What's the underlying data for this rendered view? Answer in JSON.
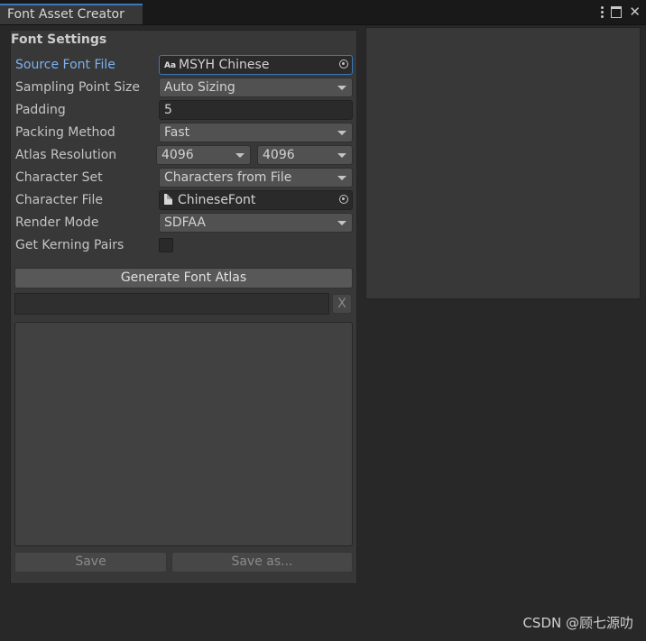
{
  "window": {
    "tab_title": "Font Asset Creator"
  },
  "settings": {
    "section_title": "Font Settings",
    "source_font_file": {
      "label": "Source Font File",
      "value": "MSYH Chinese",
      "icon": "Aa"
    },
    "sampling_point_size": {
      "label": "Sampling Point Size",
      "value": "Auto Sizing"
    },
    "padding": {
      "label": "Padding",
      "value": "5"
    },
    "packing_method": {
      "label": "Packing Method",
      "value": "Fast"
    },
    "atlas_resolution": {
      "label": "Atlas Resolution",
      "width": "4096",
      "height": "4096"
    },
    "character_set": {
      "label": "Character Set",
      "value": "Characters from File"
    },
    "character_file": {
      "label": "Character File",
      "value": "ChineseFont"
    },
    "render_mode": {
      "label": "Render Mode",
      "value": "SDFAA"
    },
    "get_kerning_pairs": {
      "label": "Get Kerning Pairs",
      "checked": false
    }
  },
  "actions": {
    "generate_label": "Generate Font Atlas",
    "clear_label": "X",
    "save_label": "Save",
    "save_as_label": "Save as..."
  },
  "watermark": "CSDN @顾七源叻",
  "colors": {
    "accent": "#3a79bb",
    "active_label": "#7bb1ef",
    "panel_bg": "#383838"
  }
}
